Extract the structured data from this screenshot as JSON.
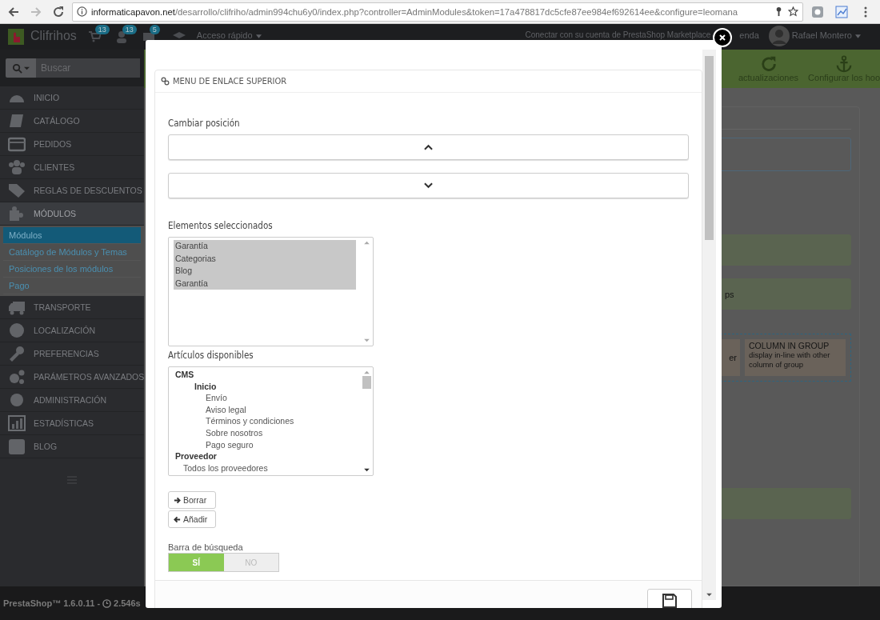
{
  "browser": {
    "url_host": "informaticapavon.net",
    "url_path": "/desarrollo/clifriho/admin994chu6y0/index.php?controller=AdminModules&token=17a478817dc5cfe87ee984ef692614ee&configure=leomana"
  },
  "topbar": {
    "shop": "Clifrihos",
    "badges": [
      "13",
      "13",
      "5"
    ],
    "quick_access": "Acceso rápido",
    "marketplace": "Conectar con su cuenta de PrestaShop Marketplace",
    "store_partial": "enda",
    "user": "Rafael Montero"
  },
  "sidebar": {
    "search_placeholder": "Buscar",
    "items": [
      {
        "label": "INICIO",
        "selected": false
      },
      {
        "label": "CATÁLOGO",
        "selected": false
      },
      {
        "label": "PEDIDOS",
        "selected": false
      },
      {
        "label": "CLIENTES",
        "selected": false
      },
      {
        "label": "REGLAS DE DESCUENTOS",
        "selected": false
      },
      {
        "label": "MÓDULOS",
        "selected": true,
        "children": [
          {
            "label": "Módulos",
            "selected": true
          },
          {
            "label": "Catálogo de Módulos y Temas",
            "selected": false
          },
          {
            "label": "Posiciones de los módulos",
            "selected": false
          },
          {
            "label": "Pago",
            "selected": false
          }
        ]
      },
      {
        "label": "TRANSPORTE",
        "selected": false
      },
      {
        "label": "LOCALIZACIÓN",
        "selected": false
      },
      {
        "label": "PREFERENCIAS",
        "selected": false
      },
      {
        "label": "PARÁMETROS AVANZADOS",
        "selected": false
      },
      {
        "label": "ADMINISTRACIÓN",
        "selected": false
      },
      {
        "label": "ESTADÍSTICAS",
        "selected": false
      },
      {
        "label": "BLOG",
        "selected": false
      }
    ],
    "footer_version": "PrestaShop™ 1.6.0.11 -",
    "footer_time": "2.546s"
  },
  "toolbar": {
    "buttons": [
      "actualizaciones",
      "Configurar los hoo"
    ]
  },
  "background": {
    "fragment_1": "ps",
    "fragment_2": "er",
    "column_title": "COLUMN IN GROUP",
    "column_text": "display in-line with other column of group"
  },
  "modal": {
    "panel_title": "MENU DE ENLACE SUPERIOR",
    "position_label": "Cambiar posición",
    "selected_label": "Elementos seleccionados",
    "selected_items": [
      {
        "label": "Garantía",
        "selected": true
      },
      {
        "label": "Categorias",
        "selected": true
      },
      {
        "label": "Blog",
        "selected": true
      },
      {
        "label": "Garantía",
        "selected": true
      }
    ],
    "available_label": "Artículos disponibles",
    "available": [
      {
        "label": "CMS",
        "kind": "group",
        "children": [
          {
            "label": "Inicio",
            "kind": "category",
            "children": [
              {
                "label": "Envío",
                "kind": "page"
              },
              {
                "label": "Aviso legal",
                "kind": "page"
              },
              {
                "label": "Términos y condiciones",
                "kind": "page"
              },
              {
                "label": "Sobre nosotros",
                "kind": "page"
              },
              {
                "label": "Pago seguro",
                "kind": "page"
              }
            ]
          }
        ]
      },
      {
        "label": "Proveedor",
        "kind": "group",
        "children": [
          {
            "label": "Todos los proveedores",
            "kind": "entry"
          }
        ]
      }
    ],
    "remove_button": "Borrar",
    "add_button": "Añadir",
    "search_bar_label": "Barra de búsqueda",
    "toggle": [
      {
        "label": "SÍ",
        "selected": true
      },
      {
        "label": "NO",
        "selected": false
      }
    ]
  }
}
